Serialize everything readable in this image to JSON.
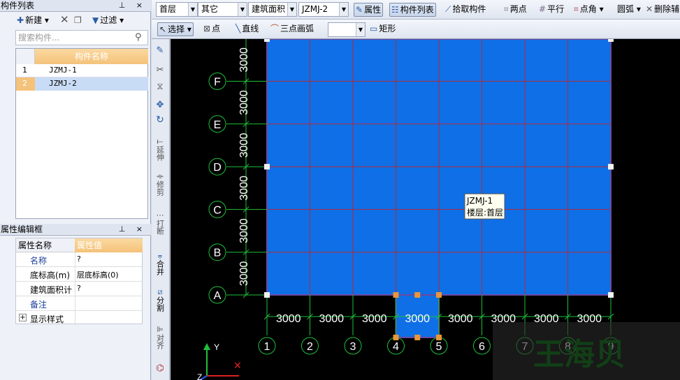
{
  "component_panel": {
    "title": "构件列表",
    "new_label": "新建",
    "filter_label": "过滤",
    "search_placeholder": "搜索构件...",
    "column_header": "构件名称",
    "rows": [
      {
        "index": "1",
        "name": "JZMJ-1"
      },
      {
        "index": "2",
        "name": "JZMJ-2"
      }
    ]
  },
  "property_panel": {
    "title": "属性编辑框",
    "col_name": "属性名称",
    "col_value": "属性值",
    "rows": [
      {
        "name": "名称",
        "value": "?"
      },
      {
        "name": "底标高(m)",
        "value": "层底标高(0)"
      },
      {
        "name": "建筑面积计",
        "value": "?"
      },
      {
        "name": "备注",
        "value": ""
      },
      {
        "name": "显示样式",
        "value": ""
      }
    ],
    "expand_symbol": "+"
  },
  "toolbar1": {
    "floor": "首层",
    "category": "其它",
    "type": "建筑面积",
    "component": "JZMJ-2",
    "properties_label": "属性",
    "component_list_label": "构件列表",
    "pick_label": "拾取构件",
    "two_points_label": "两点",
    "parallel_label": "平行",
    "point_angle_label": "点角",
    "arc_label": "圆弧",
    "delete_label": "删除辅"
  },
  "toolbar2": {
    "select_label": "选择",
    "point_label": "点",
    "line_label": "直线",
    "arc3_label": "三点画弧",
    "rect_label": "矩形"
  },
  "sidebar": {
    "extend": "延伸",
    "trim": "修剪",
    "break": "打断",
    "merge": "合并",
    "split": "分割",
    "align": "对齐"
  },
  "canvas": {
    "axes_rows": [
      "F",
      "E",
      "D",
      "C",
      "B",
      "A"
    ],
    "axes_cols": [
      "1",
      "2",
      "3",
      "4",
      "5",
      "6",
      "7",
      "8",
      "9"
    ],
    "row_spacings": [
      "3000",
      "3000",
      "3000",
      "3000",
      "3000",
      "3000"
    ],
    "col_spacings": [
      "3000",
      "3000",
      "3000",
      "3000",
      "3000",
      "3000",
      "3000",
      "3000"
    ],
    "tooltip_name": "JZMJ-1",
    "tooltip_floor": "楼层:首层",
    "watermark": "王海贝",
    "axis_y": "Y",
    "axis_z": "Z",
    "area_color": "#0f6fe6",
    "grid_color": "#b02a3a",
    "axis_line_color": "#1fbf3a"
  }
}
